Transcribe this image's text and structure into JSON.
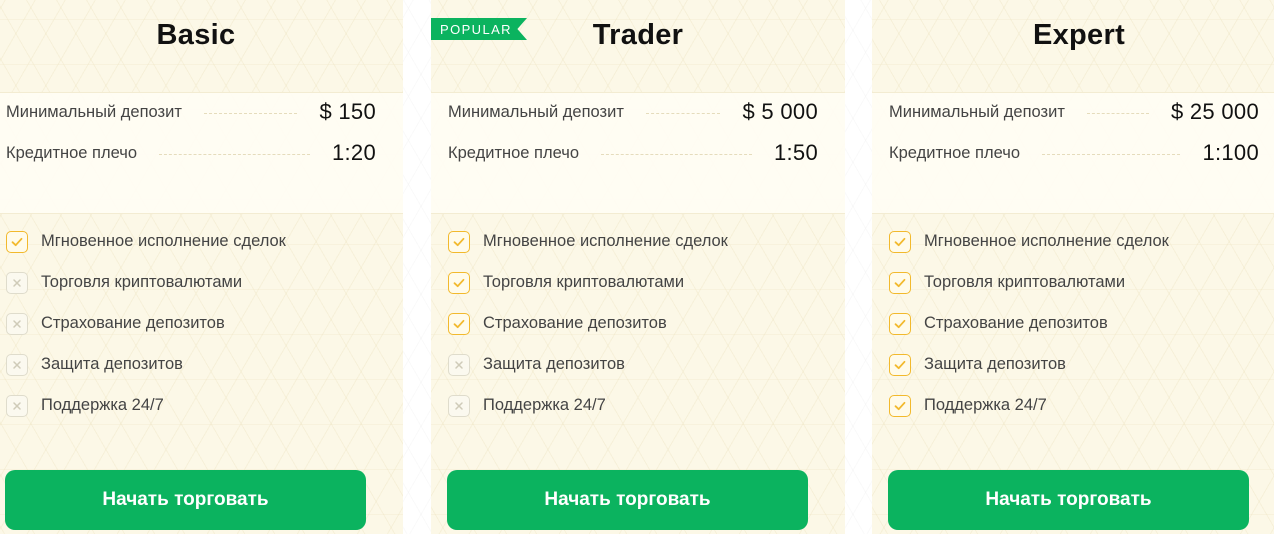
{
  "plans": [
    {
      "title": "Basic",
      "badge": "",
      "stats": [
        {
          "label": "Минимальный депозит",
          "value": "$ 150"
        },
        {
          "label": "Кредитное плечо",
          "value": "1:20"
        }
      ],
      "features": [
        {
          "label": "Мгновенное исполнение сделок",
          "included": true
        },
        {
          "label": "Торговля криптовалютами",
          "included": false
        },
        {
          "label": "Страхование депозитов",
          "included": false
        },
        {
          "label": "Защита депозитов",
          "included": false
        },
        {
          "label": "Поддержка 24/7",
          "included": false
        }
      ],
      "cta": "Начать торговать"
    },
    {
      "title": "Trader",
      "badge": "POPULAR",
      "stats": [
        {
          "label": "Минимальный депозит",
          "value": "$ 5 000"
        },
        {
          "label": "Кредитное плечо",
          "value": "1:50"
        }
      ],
      "features": [
        {
          "label": "Мгновенное исполнение сделок",
          "included": true
        },
        {
          "label": "Торговля криптовалютами",
          "included": true
        },
        {
          "label": "Страхование депозитов",
          "included": true
        },
        {
          "label": "Защита депозитов",
          "included": false
        },
        {
          "label": "Поддержка 24/7",
          "included": false
        }
      ],
      "cta": "Начать торговать"
    },
    {
      "title": "Expert",
      "badge": "",
      "stats": [
        {
          "label": "Минимальный депозит",
          "value": "$ 25 000"
        },
        {
          "label": "Кредитное плечо",
          "value": "1:100"
        }
      ],
      "features": [
        {
          "label": "Мгновенное исполнение сделок",
          "included": true
        },
        {
          "label": "Торговля криптовалютами",
          "included": true
        },
        {
          "label": "Страхование депозитов",
          "included": true
        },
        {
          "label": "Защита депозитов",
          "included": true
        },
        {
          "label": "Поддержка 24/7",
          "included": true
        }
      ],
      "cta": "Начать торговать"
    }
  ],
  "colors": {
    "accent_green": "#0bb35f",
    "check_yellow": "#f2b92d",
    "card_background": "#fcf8e7"
  },
  "icons": {
    "included": "checkmark-icon",
    "excluded": "cross-icon"
  }
}
